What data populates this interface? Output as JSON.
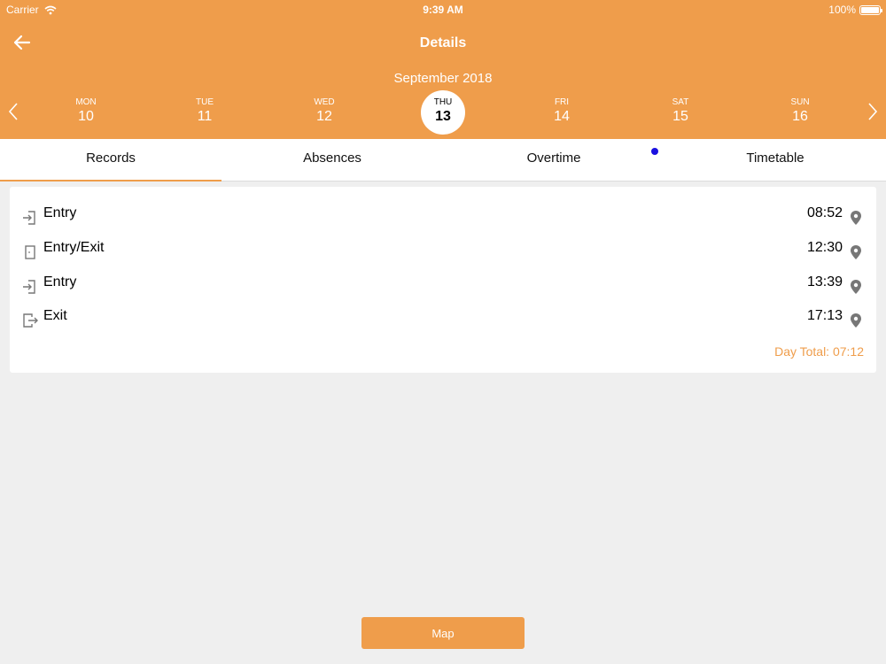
{
  "status_bar": {
    "carrier": "Carrier",
    "time": "9:39 AM",
    "battery": "100%"
  },
  "header": {
    "title": "Details",
    "month": "September 2018"
  },
  "week": {
    "days": [
      {
        "name": "MON",
        "num": "10"
      },
      {
        "name": "TUE",
        "num": "11"
      },
      {
        "name": "WED",
        "num": "12"
      },
      {
        "name": "THU",
        "num": "13",
        "selected": true
      },
      {
        "name": "FRI",
        "num": "14"
      },
      {
        "name": "SAT",
        "num": "15"
      },
      {
        "name": "SUN",
        "num": "16"
      }
    ]
  },
  "tabs": [
    {
      "label": "Records",
      "active": true
    },
    {
      "label": "Absences"
    },
    {
      "label": "Overtime",
      "badge": true
    },
    {
      "label": "Timetable"
    }
  ],
  "records": [
    {
      "icon": "entry-icon",
      "label": "Entry",
      "time": "08:52"
    },
    {
      "icon": "entry-exit-icon",
      "label": "Entry/Exit",
      "time": "12:30"
    },
    {
      "icon": "entry-icon",
      "label": "Entry",
      "time": "13:39"
    },
    {
      "icon": "exit-icon",
      "label": "Exit",
      "time": "17:13"
    }
  ],
  "day_total": "Day Total: 07:12",
  "map_button": "Map",
  "colors": {
    "accent": "#ef9d4b",
    "badge": "#1a10e0",
    "background": "#efefef"
  }
}
